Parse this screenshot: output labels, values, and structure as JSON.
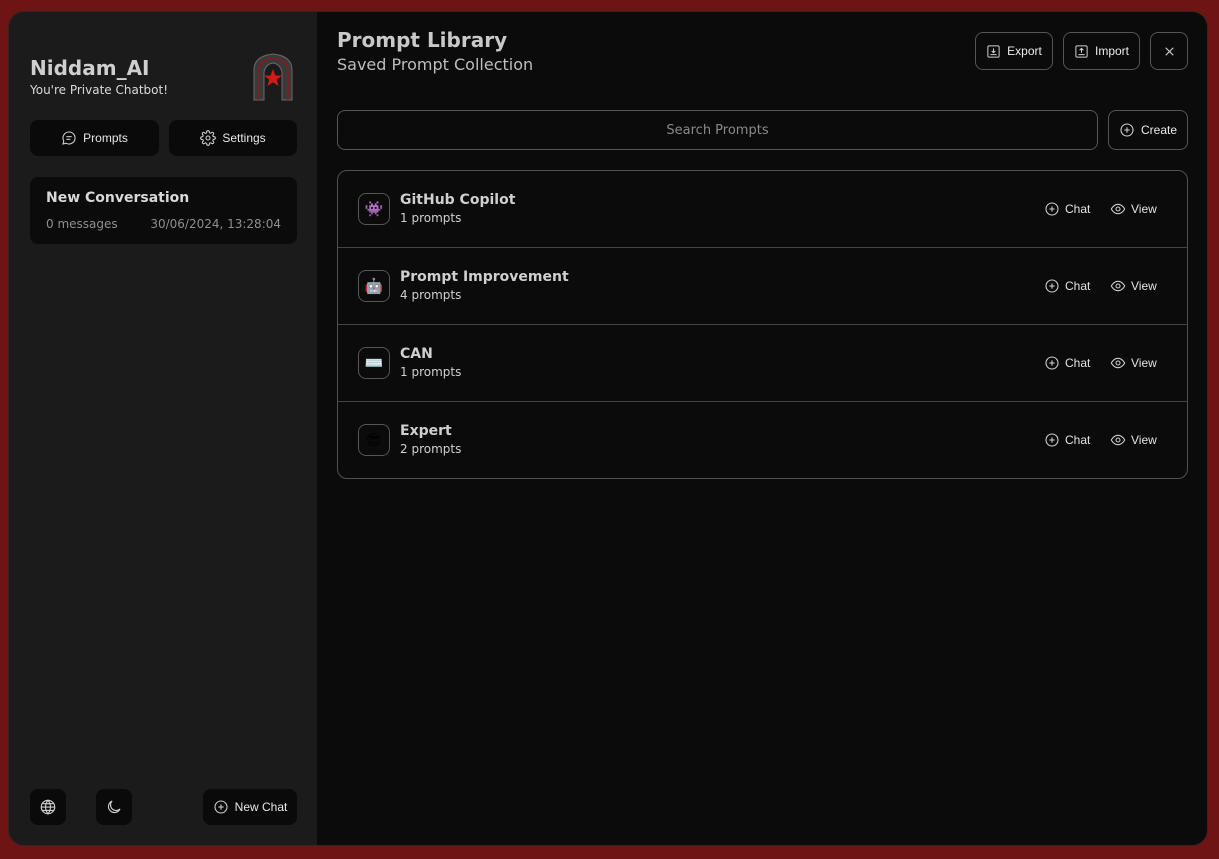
{
  "sidebar": {
    "brand_name": "Niddam_AI",
    "brand_tagline": "You're Private Chatbot!",
    "prompts_label": "Prompts",
    "settings_label": "Settings",
    "conversations": [
      {
        "title": "New Conversation",
        "messages": "0 messages",
        "date": "30/06/2024, 13:28:04"
      }
    ],
    "language_icon": "globe-icon",
    "theme_icon": "moon-icon",
    "new_chat_label": "New Chat"
  },
  "main": {
    "title": "Prompt Library",
    "subtitle": "Saved Prompt Collection",
    "export_label": "Export",
    "import_label": "Import",
    "close_icon": "close-icon",
    "search_placeholder": "Search Prompts",
    "create_label": "Create",
    "collections": [
      {
        "icon": "👾",
        "name": "GitHub Copilot",
        "count": "1 prompts",
        "chat_label": "Chat",
        "view_label": "View"
      },
      {
        "icon": "🤖",
        "name": "Prompt Improvement",
        "count": "4 prompts",
        "chat_label": "Chat",
        "view_label": "View"
      },
      {
        "icon": "⌨️",
        "name": "CAN",
        "count": "1 prompts",
        "chat_label": "Chat",
        "view_label": "View"
      },
      {
        "icon": "😎",
        "name": "Expert",
        "count": "2 prompts",
        "chat_label": "Chat",
        "view_label": "View"
      }
    ]
  },
  "colors": {
    "background_frame": "#6e1414",
    "sidebar_bg": "#1c1b1c",
    "main_bg": "#0b0b0b",
    "logo_accent": "#d11a1a"
  }
}
